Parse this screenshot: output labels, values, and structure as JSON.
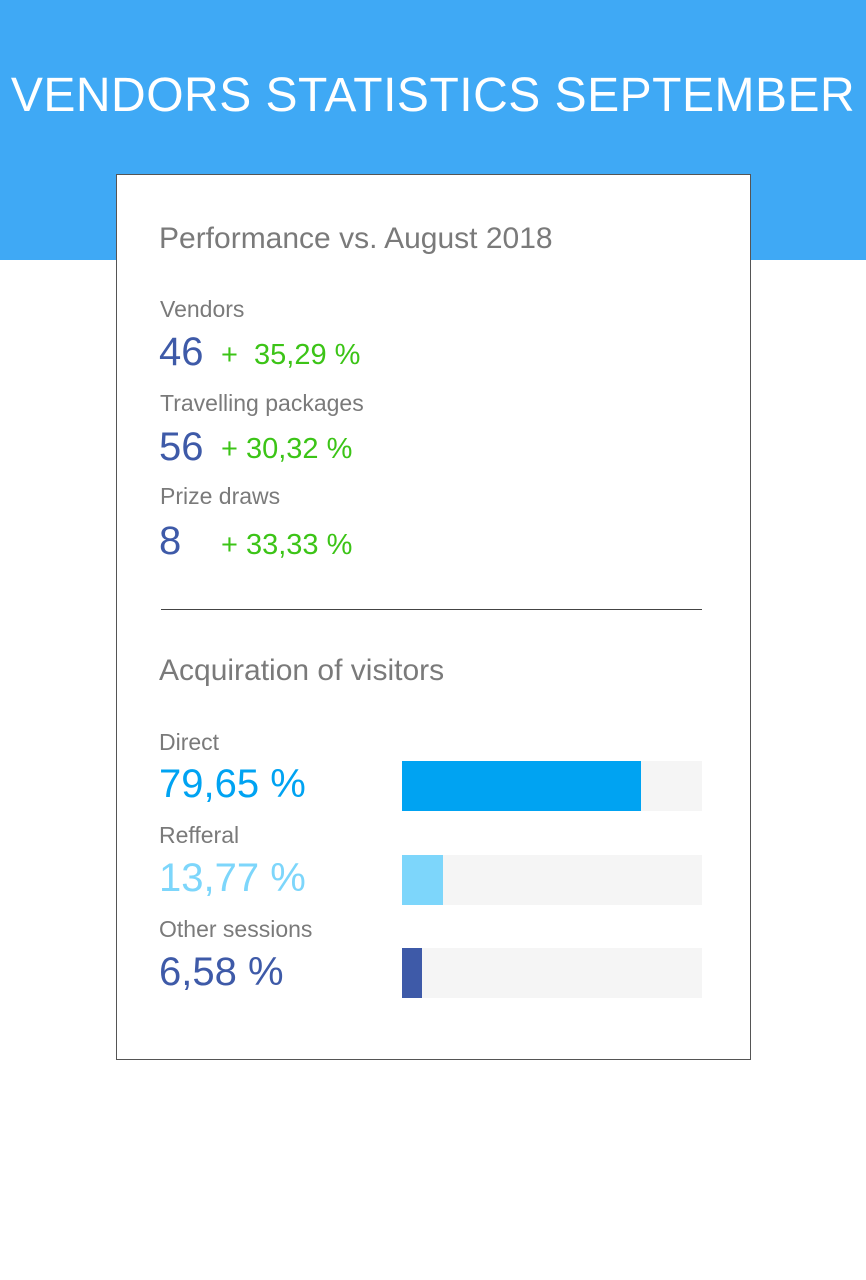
{
  "header": {
    "title": "VENDORS STATISTICS SEPTEMBER",
    "background_color": "#3fa9f5"
  },
  "performance": {
    "title": "Performance vs. August 2018",
    "metrics": [
      {
        "label": "Vendors",
        "value": "46",
        "change": "+  35,29 %"
      },
      {
        "label": "Travelling packages",
        "value": "56",
        "change": "+ 30,32 %"
      },
      {
        "label": "Prize draws",
        "value": "8",
        "change": "+ 33,33 %"
      }
    ],
    "value_color": "#3e5aa8",
    "change_color": "#3cc417"
  },
  "chart_data": {
    "type": "bar",
    "title": "Acquiration of visitors",
    "categories": [
      "Direct",
      "Refferal",
      "Other sessions"
    ],
    "values": [
      79.65,
      13.77,
      6.58
    ],
    "value_labels": [
      "79,65 %",
      "13,77 %",
      "6,58 %"
    ],
    "colors": [
      "#00a3f2",
      "#7dd6fb",
      "#3e5aa8"
    ],
    "ylim": [
      0,
      100
    ],
    "orientation": "horizontal",
    "grid": false
  }
}
